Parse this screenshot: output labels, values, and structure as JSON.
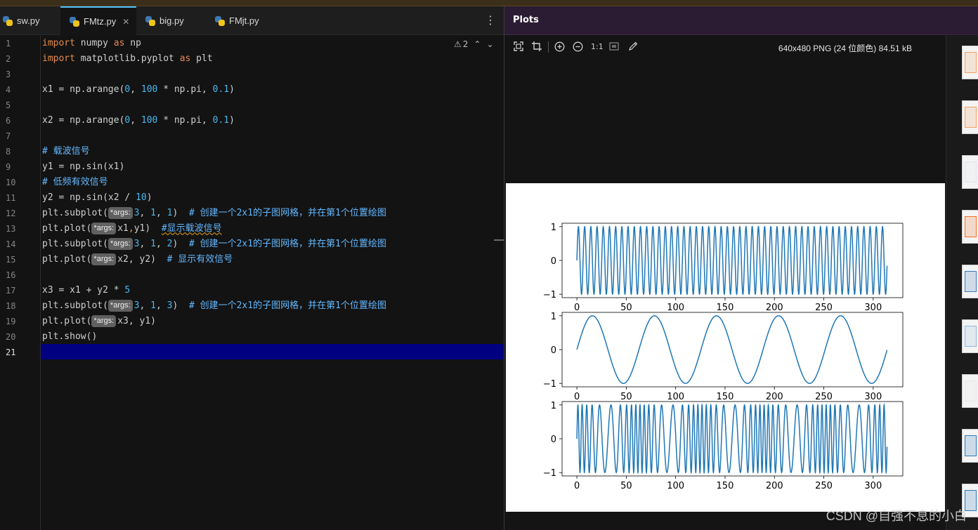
{
  "editor": {
    "tabs": [
      {
        "label": "sw.py",
        "active": false
      },
      {
        "label": "FMtz.py",
        "active": true
      },
      {
        "label": "big.py",
        "active": false
      },
      {
        "label": "FMjt.py",
        "active": false
      }
    ],
    "warning_count": "2",
    "current_line": 21,
    "line_numbers": [
      "1",
      "2",
      "3",
      "4",
      "5",
      "6",
      "7",
      "8",
      "9",
      "10",
      "11",
      "12",
      "13",
      "14",
      "15",
      "16",
      "17",
      "18",
      "19",
      "20",
      "21"
    ]
  },
  "plots": {
    "title": "Plots",
    "image_info": "640x480 PNG (24 位颜色) 84.51 kB",
    "zoom_label": "1:1"
  },
  "chart_data": [
    {
      "type": "line",
      "title": "",
      "series": [
        {
          "expression": "sin(x)",
          "x_range": [
            0,
            314.1
          ],
          "step": 0.1
        }
      ],
      "xticks": [
        0,
        50,
        100,
        150,
        200,
        250,
        300
      ],
      "yticks": [
        -1,
        0,
        1
      ],
      "xlim": [
        -15,
        330
      ],
      "ylim": [
        -1.1,
        1.1
      ],
      "color": "#1f77b4"
    },
    {
      "type": "line",
      "title": "",
      "series": [
        {
          "expression": "sin(x/10)",
          "x_range": [
            0,
            314.1
          ],
          "step": 0.1
        }
      ],
      "xticks": [
        0,
        50,
        100,
        150,
        200,
        250,
        300
      ],
      "yticks": [
        -1,
        0,
        1
      ],
      "xlim": [
        -15,
        330
      ],
      "ylim": [
        -1.1,
        1.1
      ],
      "color": "#1f77b4"
    },
    {
      "type": "line",
      "title": "",
      "series": [
        {
          "expression": "sin(x + 5*sin(x/10))",
          "x_range": [
            0,
            314.1
          ],
          "step": 0.1
        }
      ],
      "xticks": [
        0,
        50,
        100,
        150,
        200,
        250,
        300
      ],
      "yticks": [
        -1,
        0,
        1
      ],
      "xlim": [
        -15,
        330
      ],
      "ylim": [
        -1.1,
        1.1
      ],
      "color": "#1f77b4"
    }
  ],
  "watermark": "CSDN @自强不息的小白",
  "colors": {
    "accent": "#4fc1ff",
    "plots_header": "#2b1c33",
    "current_line": "#000080",
    "keyword": "#e38c4e",
    "number": "#4ab7f0"
  },
  "code": {
    "l1": [
      "import",
      " numpy ",
      "as",
      " np"
    ],
    "l2": [
      "import",
      " matplotlib.pyplot ",
      "as",
      " plt"
    ],
    "l4": [
      "x1 = np.arange(",
      "0",
      ", ",
      "100",
      " * np.pi, ",
      "0.1",
      ")"
    ],
    "l6": [
      "x2 = np.arange(",
      "0",
      ", ",
      "100",
      " * np.pi, ",
      "0.1",
      ")"
    ],
    "l8": "# 载波信号",
    "l9": "y1 = np.sin(x1)",
    "l10": "# 低频有效信号",
    "l11": [
      "y2 = np.sin(x2 / ",
      "10",
      ")"
    ],
    "l12": [
      "plt.subplot(",
      "*args:",
      "3",
      ", ",
      "1",
      ", ",
      "1",
      ")  ",
      "# 创建一个2x1的子图网格，并在第1个位置绘图"
    ],
    "l13": [
      "plt.plot(",
      "*args:",
      "x1",
      ",",
      "y1)  ",
      "#显示载波信号"
    ],
    "l14": [
      "plt.subplot(",
      "*args:",
      "3",
      ", ",
      "1",
      ", ",
      "2",
      ")  ",
      "# 创建一个2x1的子图网格，并在第1个位置绘图"
    ],
    "l15": [
      "plt.plot(",
      "*args:",
      "x2, y2)  ",
      "# 显示有效信号"
    ],
    "l17": [
      "x3 = x1 + y2 * ",
      "5"
    ],
    "l18": [
      "plt.subplot(",
      "*args:",
      "3",
      ", ",
      "1",
      ", ",
      "3",
      ")  ",
      "# 创建一个2x1的子图网格，并在第1个位置绘图"
    ],
    "l19": [
      "plt.plot(",
      "*args:",
      "x3, y1)"
    ],
    "l20": "plt.show()"
  }
}
